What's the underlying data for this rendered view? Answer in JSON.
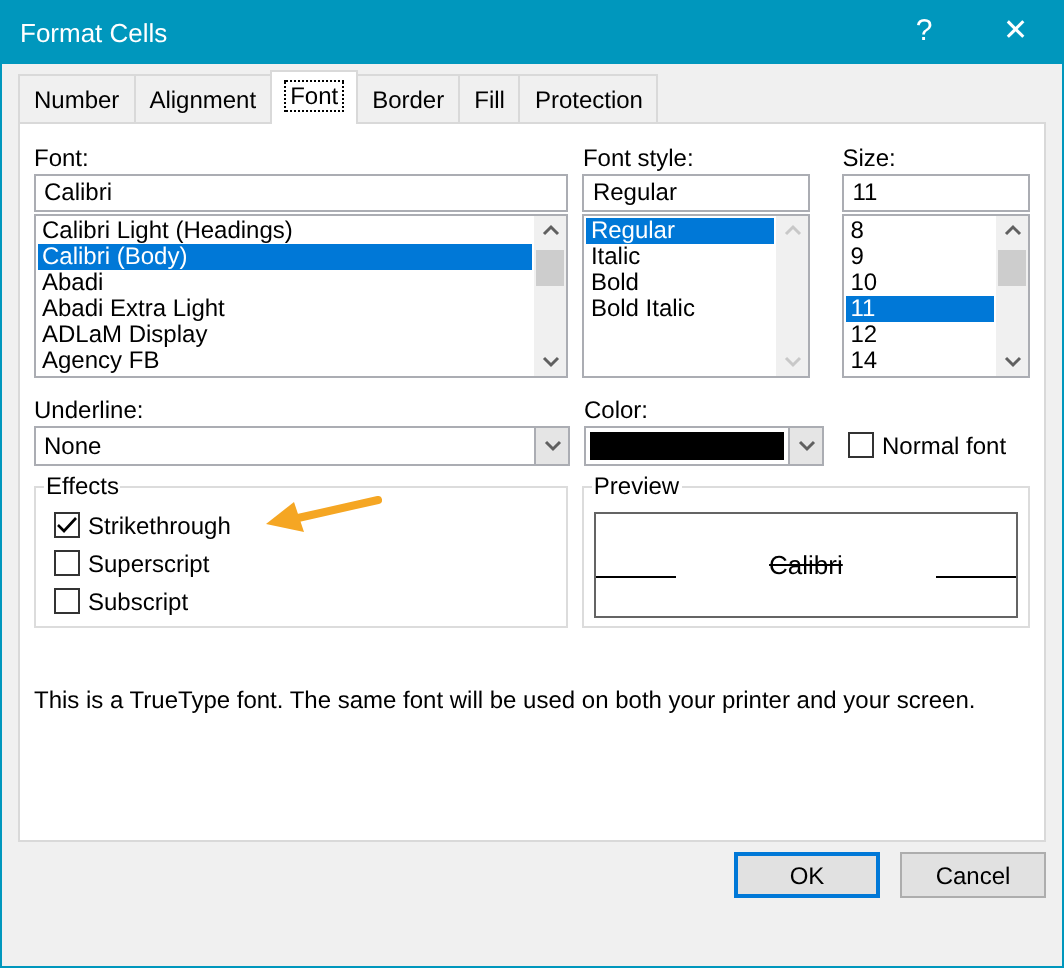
{
  "window": {
    "title": "Format Cells",
    "help": "?",
    "close": "✕"
  },
  "tabs": [
    {
      "label": "Number",
      "selected": false
    },
    {
      "label": "Alignment",
      "selected": false
    },
    {
      "label": "Font",
      "selected": true
    },
    {
      "label": "Border",
      "selected": false
    },
    {
      "label": "Fill",
      "selected": false
    },
    {
      "label": "Protection",
      "selected": false
    }
  ],
  "font": {
    "label": "Font:",
    "value": "Calibri",
    "items": [
      {
        "label": "Calibri Light (Headings)",
        "selected": false
      },
      {
        "label": "Calibri (Body)",
        "selected": true
      },
      {
        "label": "Abadi",
        "selected": false
      },
      {
        "label": "Abadi Extra Light",
        "selected": false
      },
      {
        "label": "ADLaM Display",
        "selected": false
      },
      {
        "label": "Agency FB",
        "selected": false
      }
    ]
  },
  "font_style": {
    "label": "Font style:",
    "value": "Regular",
    "items": [
      {
        "label": "Regular",
        "selected": true
      },
      {
        "label": "Italic",
        "selected": false
      },
      {
        "label": "Bold",
        "selected": false
      },
      {
        "label": "Bold Italic",
        "selected": false
      }
    ]
  },
  "size": {
    "label": "Size:",
    "value": "11",
    "items": [
      {
        "label": "8",
        "selected": false
      },
      {
        "label": "9",
        "selected": false
      },
      {
        "label": "10",
        "selected": false
      },
      {
        "label": "11",
        "selected": true
      },
      {
        "label": "12",
        "selected": false
      },
      {
        "label": "14",
        "selected": false
      }
    ]
  },
  "underline": {
    "label": "Underline:",
    "value": "None"
  },
  "color": {
    "label": "Color:",
    "color": "#000000"
  },
  "normal_font": {
    "label": "Normal font",
    "checked": false
  },
  "effects": {
    "title": "Effects",
    "items": [
      {
        "kind": "strikethrough",
        "label": "Strikethrough",
        "checked": true
      },
      {
        "kind": "superscript",
        "label": "Superscript",
        "checked": false
      },
      {
        "kind": "subscript",
        "label": "Subscript",
        "checked": false
      }
    ]
  },
  "preview": {
    "title": "Preview",
    "sample": "Calibri"
  },
  "info": "This is a TrueType font.  The same font will be used on both your printer and your screen.",
  "buttons": [
    {
      "label": "OK",
      "default": true
    },
    {
      "label": "Cancel",
      "default": false
    }
  ]
}
